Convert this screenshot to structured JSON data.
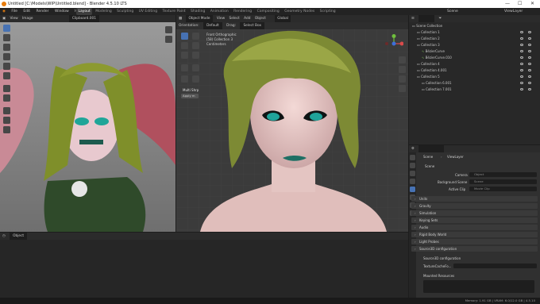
{
  "window": {
    "title": "Untitled [C:\\Models\\WIP\\Untitled.blend] - Blender 4.5.10 LTS",
    "minimize": "—",
    "maximize": "☐",
    "close": "✕"
  },
  "menu": {
    "items": [
      "File",
      "Edit",
      "Render",
      "Window",
      "Help"
    ],
    "workspaces": [
      "Layout",
      "Modeling",
      "Sculpting",
      "UV Editing",
      "Texture Paint",
      "Shading",
      "Animation",
      "Rendering",
      "Compositing",
      "Geometry Nodes",
      "Scripting"
    ],
    "active_workspace": "Layout",
    "scene_label": "Scene",
    "viewlayer_label": "ViewLayer"
  },
  "image_editor": {
    "view": "View",
    "image": "Image",
    "clipboard": "Clipboard.001"
  },
  "viewport": {
    "orientation_label": "Orientation:",
    "orientation_value": "Default",
    "drag_label": "Drag:",
    "drag_value": "Select Box",
    "mode": "Object Mode",
    "menus": [
      "View",
      "Select",
      "Add",
      "Object"
    ],
    "transform": "Global",
    "info_line1": "Front Orthographic",
    "info_line2": "(58) Collection 3",
    "info_line3": "Centimeters",
    "multi_shrp": "Multi Shrp",
    "apply": "Apply m"
  },
  "timeline": {
    "mode": "Object"
  },
  "outliner": {
    "header": "Scene Collection",
    "items": [
      {
        "label": "Collection 1",
        "indent": 1
      },
      {
        "label": "Collection 2",
        "indent": 1
      },
      {
        "label": "Collection 3",
        "indent": 1
      },
      {
        "label": "BézierCurve",
        "indent": 2
      },
      {
        "label": "BézierCurve.010",
        "indent": 2
      },
      {
        "label": "Collection 4",
        "indent": 1
      },
      {
        "label": "Collection 4.001",
        "indent": 1
      },
      {
        "label": "Collection 5",
        "indent": 1
      },
      {
        "label": "Collection 6.001",
        "indent": 2
      },
      {
        "label": "Collection 7.001",
        "indent": 2
      }
    ]
  },
  "properties": {
    "breadcrumb_scene": "Scene",
    "breadcrumb_viewlayer": "ViewLayer",
    "section": "Scene",
    "camera_label": "Camera",
    "camera_value": "Object",
    "background_label": "Background Scene",
    "background_value": "Scene",
    "active_clip_label": "Active Clip",
    "active_clip_value": "Movie Clip",
    "panels": [
      "Units",
      "Gravity",
      "Simulation",
      "Keying Sets",
      "Audio",
      "Rigid Body World",
      "Light Probes",
      "Source3D configuration"
    ],
    "src_header": "Source3D configuration",
    "texture_label": "TextureCacheFo...",
    "mounted": "Mounted Resources"
  },
  "status": {
    "text": "Memory: 1.91 GB | VRAM: 6.0/12.0 GB | 4.5.10"
  },
  "colors": {
    "accent": "#4772b3",
    "orange": "#e87d0d",
    "collection_white": "#d9d9d9",
    "curve_green": "#7fbf5a"
  }
}
